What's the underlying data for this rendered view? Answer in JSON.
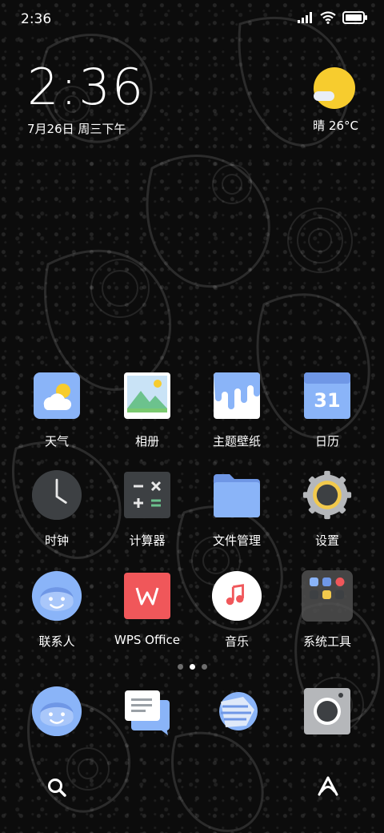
{
  "status_bar": {
    "time": "2:36",
    "icons": [
      "signal-icon",
      "wifi-icon",
      "battery-icon"
    ]
  },
  "clock_widget": {
    "time": "2:36",
    "date": "7月26日 周三下午"
  },
  "weather_widget": {
    "icon": "sun-cloud-icon",
    "text": "晴 26°C"
  },
  "apps": [
    {
      "label": "天气",
      "icon": "weather-app-icon"
    },
    {
      "label": "相册",
      "icon": "gallery-app-icon"
    },
    {
      "label": "主题壁纸",
      "icon": "themes-app-icon"
    },
    {
      "label": "日历",
      "icon": "calendar-app-icon",
      "icon_text": "31"
    },
    {
      "label": "时钟",
      "icon": "clock-app-icon"
    },
    {
      "label": "计算器",
      "icon": "calculator-app-icon"
    },
    {
      "label": "文件管理",
      "icon": "files-app-icon"
    },
    {
      "label": "设置",
      "icon": "settings-app-icon"
    },
    {
      "label": "联系人",
      "icon": "contacts-app-icon"
    },
    {
      "label": "WPS Office",
      "icon": "wps-office-app-icon"
    },
    {
      "label": "音乐",
      "icon": "music-app-icon"
    },
    {
      "label": "系统工具",
      "icon": "system-tools-folder-icon"
    }
  ],
  "page_indicator": {
    "pages": 3,
    "current": 2
  },
  "dock": [
    {
      "icon": "phone-contacts-icon"
    },
    {
      "icon": "messages-icon"
    },
    {
      "icon": "browser-icon"
    },
    {
      "icon": "camera-icon"
    }
  ],
  "bottom_bar": {
    "left_icon": "search-icon",
    "right_icon": "assistant-icon"
  },
  "colors": {
    "weather_sun": "#f7cc2e",
    "app_blue": "#8ab4f8",
    "wps_red": "#f0575a",
    "settings_yellow": "#f2c94c"
  }
}
